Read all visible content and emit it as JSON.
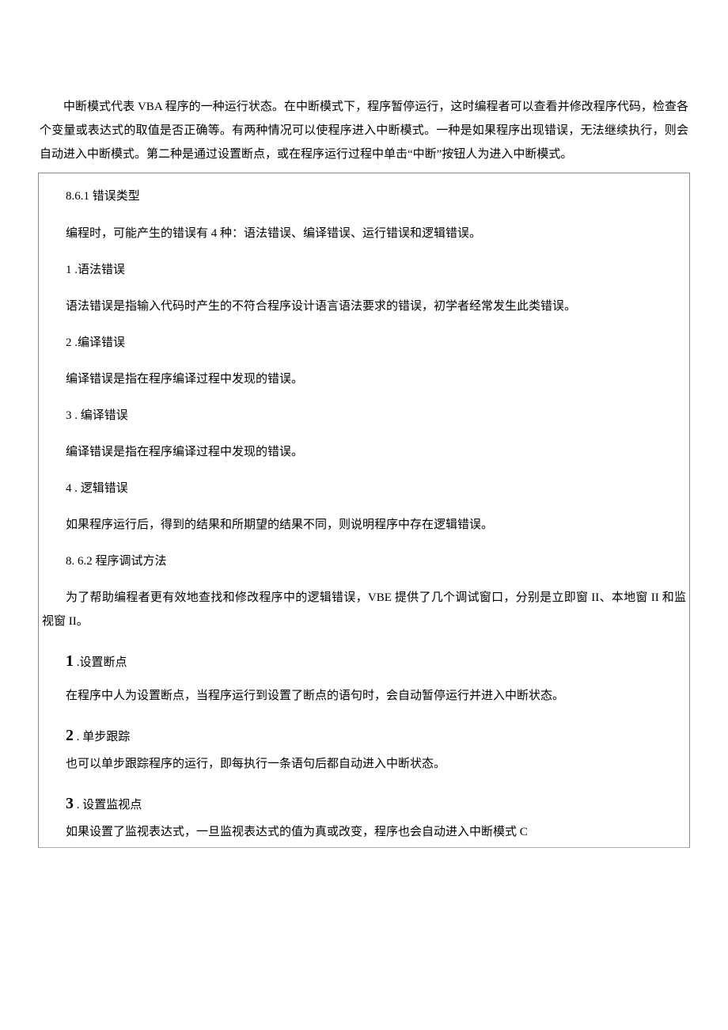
{
  "intro": {
    "p1": "中断模式代表 VBA 程序的一种运行状态。在中断模式下，程序暂停运行，这时编程者可以查看并修改程序代码，检查各个变量或表达式的取值是否正确等。有两种情况可以使程序进入中断模式。一种是如果程序出现错误，无法继续执行，则会自动进入中断模式。第二种是通过设置断点，或在程序运行过程中单击“中断”按钮人为进入中断模式。"
  },
  "box": {
    "sec1_title": "8.6.1 错误类型",
    "sec1_p1": "编程时，可能产生的错误有 4 种：语法错误、编译错误、运行错误和逻辑错误。",
    "item1_label": "1  .语法错误",
    "item1_body": "语法错误是指输入代码时产生的不符合程序设计语言语法要求的错误，初学者经常发生此类错误。",
    "item2_label": "2  .编译错误",
    "item2_body": "编译错误是指在程序编译过程中发现的错误。",
    "item3_label": "3  . 编译错误",
    "item3_body": "编译错误是指在程序编译过程中发现的错误。",
    "item4_label": "4  . 逻辑错误",
    "item4_body": "如果程序运行后，得到的结果和所期望的结果不同，则说明程序中存在逻辑错误。",
    "sec2_title": "8.   6.2 程序调试方法",
    "sec2_p1": "为了帮助编程者更有效地查找和修改程序中的逻辑错误，VBE 提供了几个调试窗口，分别是立即窗 II、本地窗 II 和监视窗 II。",
    "b1_num": "1",
    "b1_label": " .设置断点",
    "b1_body": "在程序中人为设置断点，当程序运行到设置了断点的语句时，会自动暂停运行并进入中断状态。",
    "b2_num": "2",
    "b2_label": "  . 单步跟踪",
    "b2_body": "也可以单步跟踪程序的运行，即每执行一条语句后都自动进入中断状态。",
    "b3_num": "3",
    "b3_label": "  . 设置监视点",
    "b3_body": "如果设置了监视表达式，一旦监视表达式的值为真或改变，程序也会自动进入中断模式 C"
  }
}
